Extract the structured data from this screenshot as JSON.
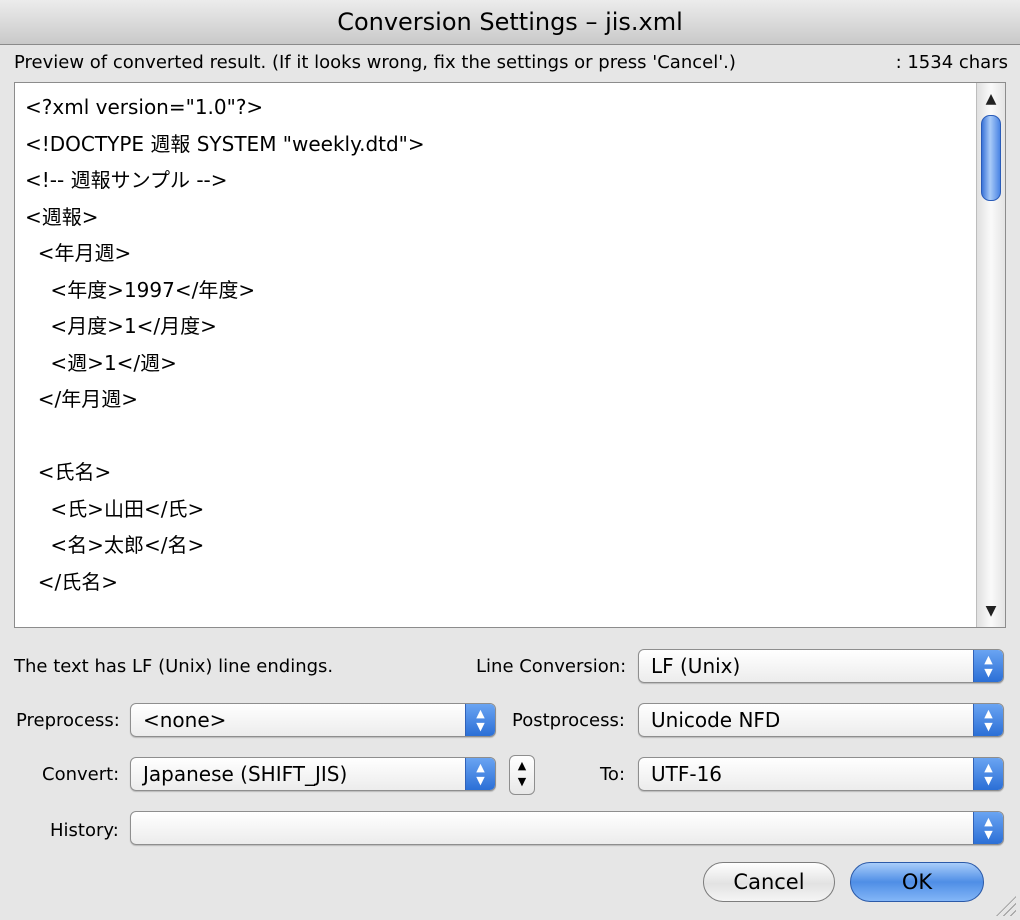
{
  "window": {
    "title": "Conversion Settings – jis.xml"
  },
  "preview": {
    "label": "Preview of converted result. (If it looks wrong, fix the settings or press 'Cancel'.)",
    "char_count": ": 1534 chars",
    "text": "<?xml version=\"1.0\"?>\n<!DOCTYPE 週報 SYSTEM \"weekly.dtd\">\n<!-- 週報サンプル -->\n<週報>\n  <年月週>\n    <年度>1997</年度>\n    <月度>1</月度>\n    <週>1</週>\n  </年月週>\n\n  <氏名>\n    <氏>山田</氏>\n    <名>太郎</名>\n  </氏名>\n\n  <業務報告リスト>",
    "scroll_up_icon": "up-arrow-icon",
    "scroll_down_icon": "down-arrow-icon"
  },
  "line_endings_text": "The text has LF (Unix) line endings.",
  "line_conversion": {
    "label": "Line Conversion:",
    "value": "LF (Unix)"
  },
  "preprocess": {
    "label": "Preprocess:",
    "value": "<none>"
  },
  "postprocess": {
    "label": "Postprocess:",
    "value": "Unicode NFD"
  },
  "convert": {
    "label": "Convert:",
    "value": "Japanese (SHIFT_JIS)"
  },
  "to": {
    "label": "To:",
    "value": "UTF-16"
  },
  "history": {
    "label": "History:",
    "value": ""
  },
  "buttons": {
    "cancel": "Cancel",
    "ok": "OK"
  },
  "colors": {
    "accent": "#3b7be0",
    "window_bg": "#e6e6e6"
  }
}
